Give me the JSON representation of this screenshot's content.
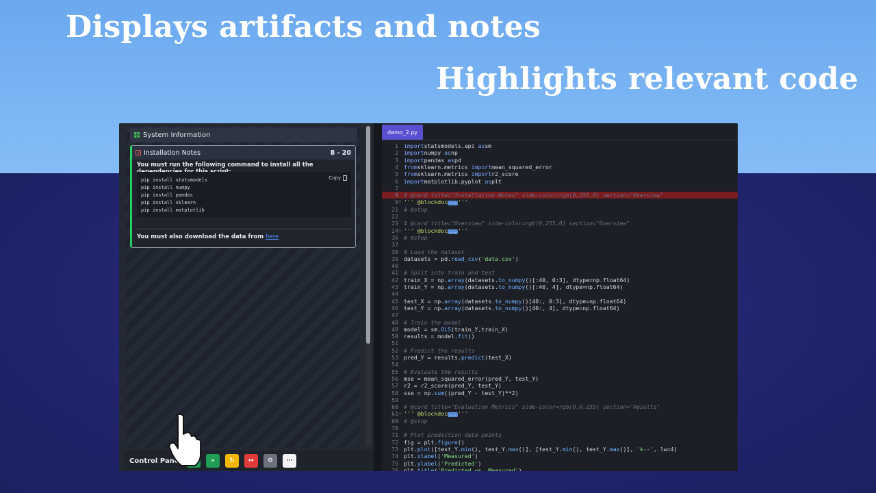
{
  "headlines": {
    "line1": "Displays artifacts and notes",
    "line2": "Highlights relevant code"
  },
  "left_panel": {
    "system_info_label": "System Information",
    "card": {
      "title": "Installation Notes",
      "range": "8 - 20",
      "intro": "You must run the following command to install all the dependencies for this script:",
      "copy_label": "Copy",
      "commands": [
        "pip install statsmodels",
        "pip install numpy",
        "pip install pandas",
        "pip install sklearn",
        "pip install matplotlib"
      ],
      "outro": "You must also download the data from",
      "link_text": "here",
      "accent_color": "#23d160"
    }
  },
  "control_panel": {
    "label": "Control Panel",
    "buttons": [
      {
        "name": "run",
        "color": "#1f9d55",
        "glyph": "▶"
      },
      {
        "name": "fast-forward",
        "color": "#1f9d55",
        "glyph": "»"
      },
      {
        "name": "refresh",
        "color": "#f2b705",
        "glyph": "↻"
      },
      {
        "name": "exit",
        "color": "#e03b3b",
        "glyph": "↦"
      },
      {
        "name": "settings",
        "color": "#6c717c",
        "glyph": "⚙"
      },
      {
        "name": "network",
        "color": "#f4f4f4",
        "glyph": "⋯"
      }
    ]
  },
  "editor": {
    "tab_label": "demo_2.py",
    "highlight_color": "#7a1b1f",
    "lines": [
      {
        "n": "1",
        "t": [
          [
            "kw",
            "import"
          ],
          [
            "",
            "statsmodels.api "
          ],
          [
            "kw",
            "as"
          ],
          [
            "",
            "sm"
          ]
        ]
      },
      {
        "n": "2",
        "t": [
          [
            "kw",
            "import"
          ],
          [
            "",
            "numpy "
          ],
          [
            "kw",
            "as"
          ],
          [
            "",
            "np"
          ]
        ]
      },
      {
        "n": "3",
        "t": [
          [
            "kw",
            "import"
          ],
          [
            "",
            "pandas "
          ],
          [
            "kw",
            "as"
          ],
          [
            "",
            "pd"
          ]
        ]
      },
      {
        "n": "4",
        "t": [
          [
            "kw",
            "from"
          ],
          [
            "",
            "sklearn.metrics "
          ],
          [
            "kw",
            "import"
          ],
          [
            "",
            "mean_squared_error"
          ]
        ]
      },
      {
        "n": "5",
        "t": [
          [
            "kw",
            "from"
          ],
          [
            "",
            "sklearn.metrics "
          ],
          [
            "kw",
            "import"
          ],
          [
            "",
            "r2_score"
          ]
        ]
      },
      {
        "n": "6",
        "t": [
          [
            "kw",
            "import"
          ],
          [
            "",
            "matplotlib.pyplot "
          ],
          [
            "kw",
            "as"
          ],
          [
            "",
            "plt"
          ]
        ]
      },
      {
        "n": "7",
        "t": []
      },
      {
        "n": "8",
        "hl": true,
        "t": [
          [
            "cm",
            "# @card title=\"Installation Notes\" side-color=rgb(0,255,0) section=\"Overview\""
          ]
        ]
      },
      {
        "n": "9",
        "fold": true,
        "t": [
          [
            "at",
            "''' @blockdoc"
          ],
          [
            "badge",
            "..."
          ],
          [
            "at",
            "'''"
          ]
        ]
      },
      {
        "n": "21",
        "t": [
          [
            "cm",
            "# @stop"
          ]
        ]
      },
      {
        "n": "22",
        "t": []
      },
      {
        "n": "23",
        "t": [
          [
            "cm",
            "# @card title=\"Overview\" side-color=rgb(0,255,0) section=\"Overview\""
          ]
        ]
      },
      {
        "n": "24",
        "fold": true,
        "t": [
          [
            "at",
            "''' @blockdoc"
          ],
          [
            "badge",
            "..."
          ],
          [
            "at",
            "'''"
          ]
        ]
      },
      {
        "n": "36",
        "t": [
          [
            "cm",
            "# @stop"
          ]
        ]
      },
      {
        "n": "37",
        "t": []
      },
      {
        "n": "38",
        "t": [
          [
            "cm",
            "# Load the dataset"
          ]
        ]
      },
      {
        "n": "39",
        "t": [
          [
            "",
            "datasets = pd."
          ],
          [
            "fn",
            "read_csv"
          ],
          [
            "",
            "("
          ],
          [
            "st",
            "'data.csv'"
          ],
          [
            "",
            ")"
          ]
        ]
      },
      {
        "n": "40",
        "t": []
      },
      {
        "n": "41",
        "t": [
          [
            "cm",
            "# Split into train and test"
          ]
        ]
      },
      {
        "n": "42",
        "t": [
          [
            "",
            "train_X = np."
          ],
          [
            "fn",
            "array"
          ],
          [
            "",
            "(datasets."
          ],
          [
            "fn",
            "to_numpy"
          ],
          [
            "",
            "()[:40, 0:3], dtype=np.float64)"
          ]
        ]
      },
      {
        "n": "43",
        "t": [
          [
            "",
            "train_Y = np."
          ],
          [
            "fn",
            "array"
          ],
          [
            "",
            "(datasets."
          ],
          [
            "fn",
            "to_numpy"
          ],
          [
            "",
            "()[:40, 4], dtype=np.float64)"
          ]
        ]
      },
      {
        "n": "44",
        "t": []
      },
      {
        "n": "45",
        "t": [
          [
            "",
            "test_X = np."
          ],
          [
            "fn",
            "array"
          ],
          [
            "",
            "(datasets."
          ],
          [
            "fn",
            "to_numpy"
          ],
          [
            "",
            "()[40:, 0:3], dtype=np.float64)"
          ]
        ]
      },
      {
        "n": "46",
        "t": [
          [
            "",
            "test_Y = np."
          ],
          [
            "fn",
            "array"
          ],
          [
            "",
            "(datasets."
          ],
          [
            "fn",
            "to_numpy"
          ],
          [
            "",
            "()[40:, 4], dtype=np.float64)"
          ]
        ]
      },
      {
        "n": "47",
        "t": []
      },
      {
        "n": "48",
        "t": [
          [
            "cm",
            "# Train the model"
          ]
        ]
      },
      {
        "n": "49",
        "t": [
          [
            "",
            "model = sm."
          ],
          [
            "fn",
            "OLS"
          ],
          [
            "",
            "(train_Y,train_X)"
          ]
        ]
      },
      {
        "n": "50",
        "t": [
          [
            "",
            "results = model."
          ],
          [
            "fn",
            "fit"
          ],
          [
            "",
            "()"
          ]
        ]
      },
      {
        "n": "51",
        "t": []
      },
      {
        "n": "52",
        "t": [
          [
            "cm",
            "# Predict the results"
          ]
        ]
      },
      {
        "n": "53",
        "t": [
          [
            "",
            "pred_Y = results."
          ],
          [
            "fn",
            "predict"
          ],
          [
            "",
            "(test_X)"
          ]
        ]
      },
      {
        "n": "54",
        "t": []
      },
      {
        "n": "55",
        "t": [
          [
            "cm",
            "# Evaluate the results"
          ]
        ]
      },
      {
        "n": "56",
        "t": [
          [
            "",
            "mse = mean_squared_error(pred_Y, test_Y)"
          ]
        ]
      },
      {
        "n": "57",
        "t": [
          [
            "",
            "r2 = r2_score(pred_Y, test_Y)"
          ]
        ]
      },
      {
        "n": "58",
        "t": [
          [
            "",
            "sse = np."
          ],
          [
            "fn",
            "sum"
          ],
          [
            "",
            "((pred_Y - test_Y)**2)"
          ]
        ]
      },
      {
        "n": "59",
        "t": []
      },
      {
        "n": "60",
        "t": [
          [
            "cm",
            "# @card title=\"Evaluation Metrics\" side-color=rgb(0,0,255) section=\"Results\""
          ]
        ]
      },
      {
        "n": "61",
        "fold": true,
        "t": [
          [
            "at",
            "''' @blockdoc"
          ],
          [
            "badge",
            "..."
          ],
          [
            "at",
            "'''"
          ]
        ]
      },
      {
        "n": "69",
        "t": [
          [
            "cm",
            "# @stop"
          ]
        ]
      },
      {
        "n": "70",
        "t": []
      },
      {
        "n": "71",
        "t": [
          [
            "cm",
            "# Plot prediction data points"
          ]
        ]
      },
      {
        "n": "72",
        "t": [
          [
            "",
            "fig = plt."
          ],
          [
            "fn",
            "figure"
          ],
          [
            "",
            "()"
          ]
        ]
      },
      {
        "n": "73",
        "t": [
          [
            "",
            "plt."
          ],
          [
            "fn",
            "plot"
          ],
          [
            "",
            "([test_Y."
          ],
          [
            "fn",
            "min"
          ],
          [
            "",
            "(), test_Y."
          ],
          [
            "fn",
            "max"
          ],
          [
            "",
            "()], [test_Y."
          ],
          [
            "fn",
            "min"
          ],
          [
            "",
            "(), test_Y."
          ],
          [
            "fn",
            "max"
          ],
          [
            "",
            "()], "
          ],
          [
            "st",
            "'k--'"
          ],
          [
            "",
            ", lw=4)"
          ]
        ]
      },
      {
        "n": "74",
        "t": [
          [
            "",
            "plt."
          ],
          [
            "fn",
            "xlabel"
          ],
          [
            "",
            "("
          ],
          [
            "st",
            "'Measured'"
          ],
          [
            "",
            ")"
          ]
        ]
      },
      {
        "n": "75",
        "t": [
          [
            "",
            "plt."
          ],
          [
            "fn",
            "ylabel"
          ],
          [
            "",
            "("
          ],
          [
            "st",
            "'Predicted'"
          ],
          [
            "",
            ")"
          ]
        ]
      },
      {
        "n": "76",
        "t": [
          [
            "",
            "plt."
          ],
          [
            "fn",
            "title"
          ],
          [
            "",
            "("
          ],
          [
            "st",
            "'Predicted vs. Measured'"
          ],
          [
            "",
            ")"
          ]
        ]
      }
    ]
  }
}
